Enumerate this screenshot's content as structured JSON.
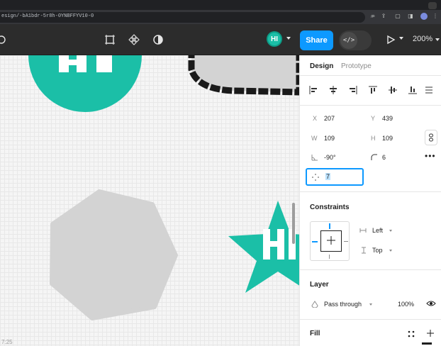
{
  "browser": {
    "url": "esign/-bA1bdr-5r8h-0YNBFFYV10-0"
  },
  "toolbar": {
    "avatar_initials": "HI",
    "share_label": "Share",
    "dev_mode_icon": "</>",
    "zoom_label": "200%"
  },
  "canvas": {
    "timestamp": "7:25",
    "teal_color": "#1bbfa7",
    "gray_shape_color": "#d3d3d3",
    "circle_logo_text": "HI",
    "star_logo_text": "HI"
  },
  "panel": {
    "tabs": {
      "design": "Design",
      "prototype": "Prototype"
    },
    "x_label": "X",
    "x_value": "207",
    "y_label": "Y",
    "y_value": "439",
    "w_label": "W",
    "w_value": "109",
    "h_label": "H",
    "h_value": "109",
    "rotation_value": "-90°",
    "radius_value": "6",
    "points_value": "7",
    "constraints": {
      "title": "Constraints",
      "horizontal": "Left",
      "vertical": "Top"
    },
    "layer": {
      "title": "Layer",
      "blend_mode": "Pass through",
      "opacity": "100%"
    },
    "fill": {
      "title": "Fill"
    }
  }
}
